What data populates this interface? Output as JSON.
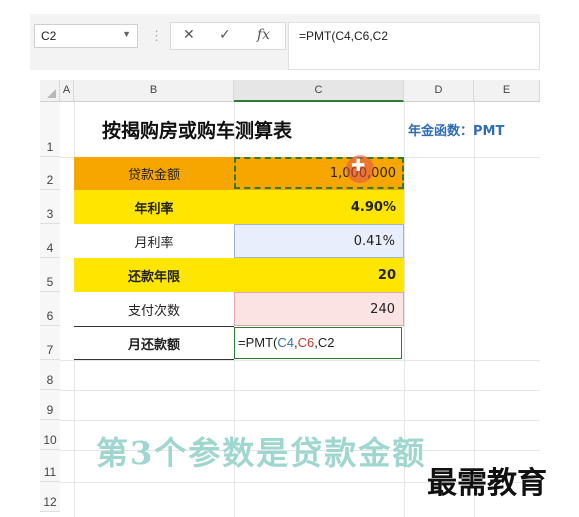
{
  "formula_bar": {
    "name_box": "C2",
    "cancel_icon": "✕",
    "enter_icon": "✓",
    "fx_label": "fx",
    "formula": "=PMT(C4,C6,C2"
  },
  "columns": [
    "A",
    "B",
    "C",
    "D",
    "E"
  ],
  "rows": [
    "1",
    "2",
    "3",
    "4",
    "5",
    "6",
    "7",
    "8",
    "9",
    "10",
    "11",
    "12"
  ],
  "sheet": {
    "title": "按揭购房或购车测算表",
    "annuity_note": "年金函数：PMT",
    "table": [
      {
        "label": "贷款金额",
        "value": "1,000,000"
      },
      {
        "label": "年利率",
        "value": "4.90%"
      },
      {
        "label": "月利率",
        "value": "0.41%"
      },
      {
        "label": "还款年限",
        "value": "20"
      },
      {
        "label": "支付次数",
        "value": "240"
      },
      {
        "label": "月还款额"
      }
    ],
    "formula_cell": {
      "prefix": "=PMT(",
      "ref1": "C4",
      "comma1": ",",
      "ref2": "C6",
      "comma2": ",",
      "ref3": "C2"
    }
  },
  "caption": "第3个参数是贷款金额",
  "logo": "最需教育",
  "colors": {
    "orange_fill": "#f7a600",
    "yellow_fill": "#ffe600",
    "blue_fill": "#e8eefb",
    "pink_fill": "#fbe3e3",
    "selection_green": "#2e7d32",
    "annuity_blue": "#2f6db5"
  }
}
